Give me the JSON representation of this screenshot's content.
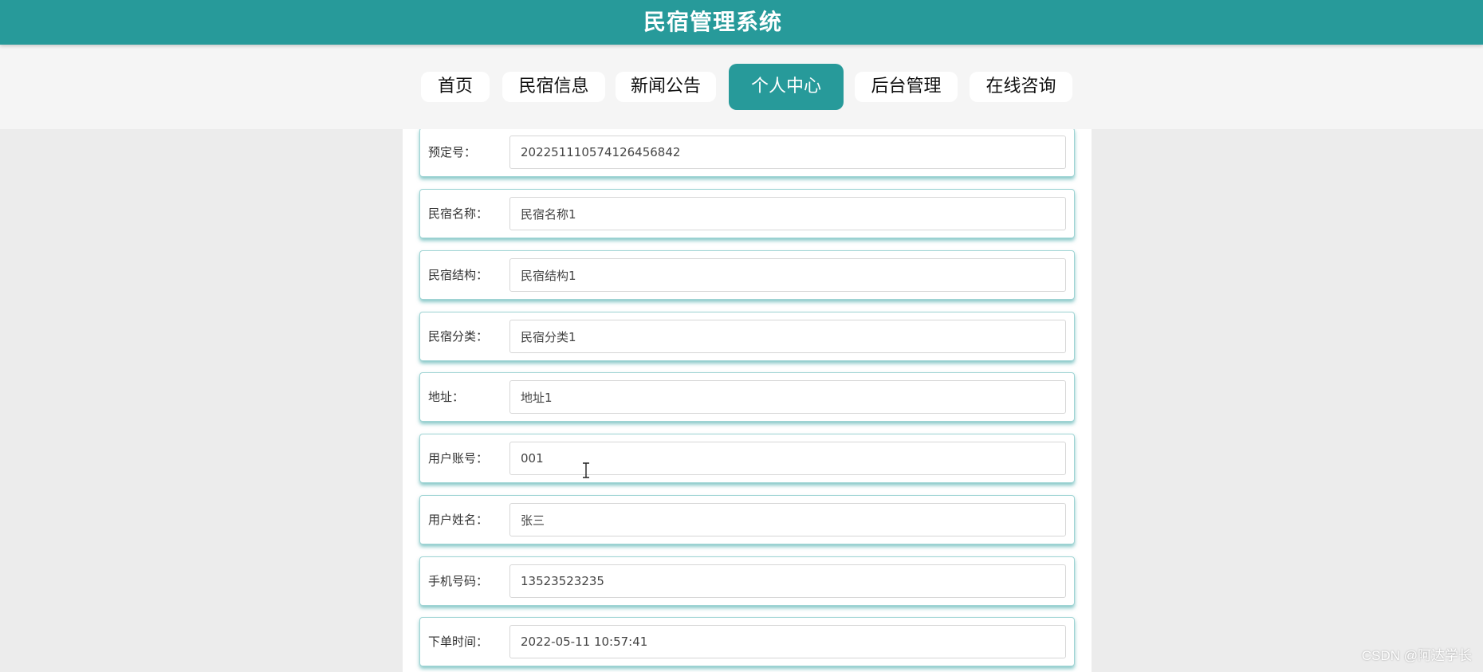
{
  "app": {
    "title": "民宿管理系统"
  },
  "nav": {
    "items": [
      {
        "label": "首页",
        "active": false
      },
      {
        "label": "民宿信息",
        "active": false
      },
      {
        "label": "新闻公告",
        "active": false
      },
      {
        "label": "个人中心",
        "active": true
      },
      {
        "label": "后台管理",
        "active": false
      },
      {
        "label": "在线咨询",
        "active": false
      }
    ]
  },
  "form": {
    "fields": [
      {
        "label": "预定号：",
        "value": "202251110574126456842"
      },
      {
        "label": "民宿名称：",
        "value": "民宿名称1"
      },
      {
        "label": "民宿结构：",
        "value": "民宿结构1"
      },
      {
        "label": "民宿分类：",
        "value": "民宿分类1"
      },
      {
        "label": "地址：",
        "value": "地址1"
      },
      {
        "label": "用户账号：",
        "value": "001"
      },
      {
        "label": "用户姓名：",
        "value": "张三"
      },
      {
        "label": "手机号码：",
        "value": "13523523235"
      },
      {
        "label": "下单时间：",
        "value": "2022-05-11 10:57:41"
      }
    ]
  },
  "watermark": "CSDN @阿达学长",
  "colors": {
    "primary": "#279a9a",
    "nav_background": "#f5f5f5",
    "page_background": "#ececec"
  },
  "icons": {
    "cursor": "text-cursor-icon"
  }
}
